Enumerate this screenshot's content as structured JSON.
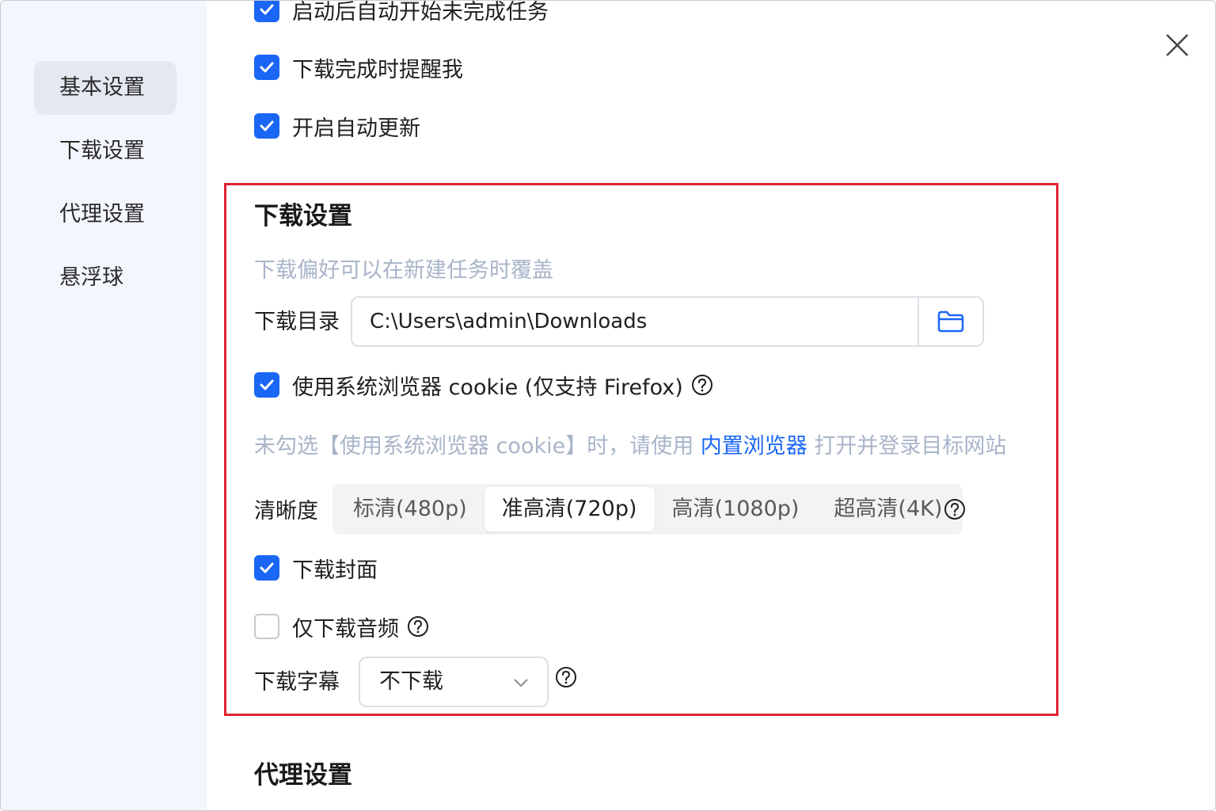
{
  "sidebar": {
    "items": [
      {
        "label": "基本设置",
        "active": true
      },
      {
        "label": "下载设置",
        "active": false
      },
      {
        "label": "代理设置",
        "active": false
      },
      {
        "label": "悬浮球",
        "active": false
      }
    ]
  },
  "basic": {
    "auto_start_label": "启动后自动开始未完成任务",
    "notify_label": "下载完成时提醒我",
    "auto_update_label": "开启自动更新"
  },
  "download": {
    "title": "下载设置",
    "subtitle": "下载偏好可以在新建任务时覆盖",
    "dir_label": "下载目录",
    "dir_value": "C:\\Users\\admin\\Downloads",
    "cookie_label": "使用系统浏览器 cookie (仅支持 Firefox)",
    "cookie_hint_prefix": "未勾选【使用系统浏览器 cookie】时，请使用 ",
    "cookie_hint_link": "内置浏览器",
    "cookie_hint_suffix": " 打开并登录目标网站",
    "quality_label": "清晰度",
    "quality_options": [
      "标清(480p)",
      "准高清(720p)",
      "高清(1080p)",
      "超高清(4K)"
    ],
    "quality_selected": "准高清(720p)",
    "cover_label": "下载封面",
    "audio_only_label": "仅下载音频",
    "subtitle_label": "下载字幕",
    "subtitle_value": "不下载"
  },
  "proxy": {
    "title": "代理设置"
  },
  "colors": {
    "accent": "#1a66f5",
    "highlight_border": "#e02230",
    "hint_text": "#a8b4c9",
    "sidebar_bg": "#f3f6fd"
  },
  "icons": {
    "close": "close-icon",
    "folder": "folder-icon",
    "help": "help-icon",
    "check": "check-icon",
    "chevron": "chevron-down-icon"
  }
}
